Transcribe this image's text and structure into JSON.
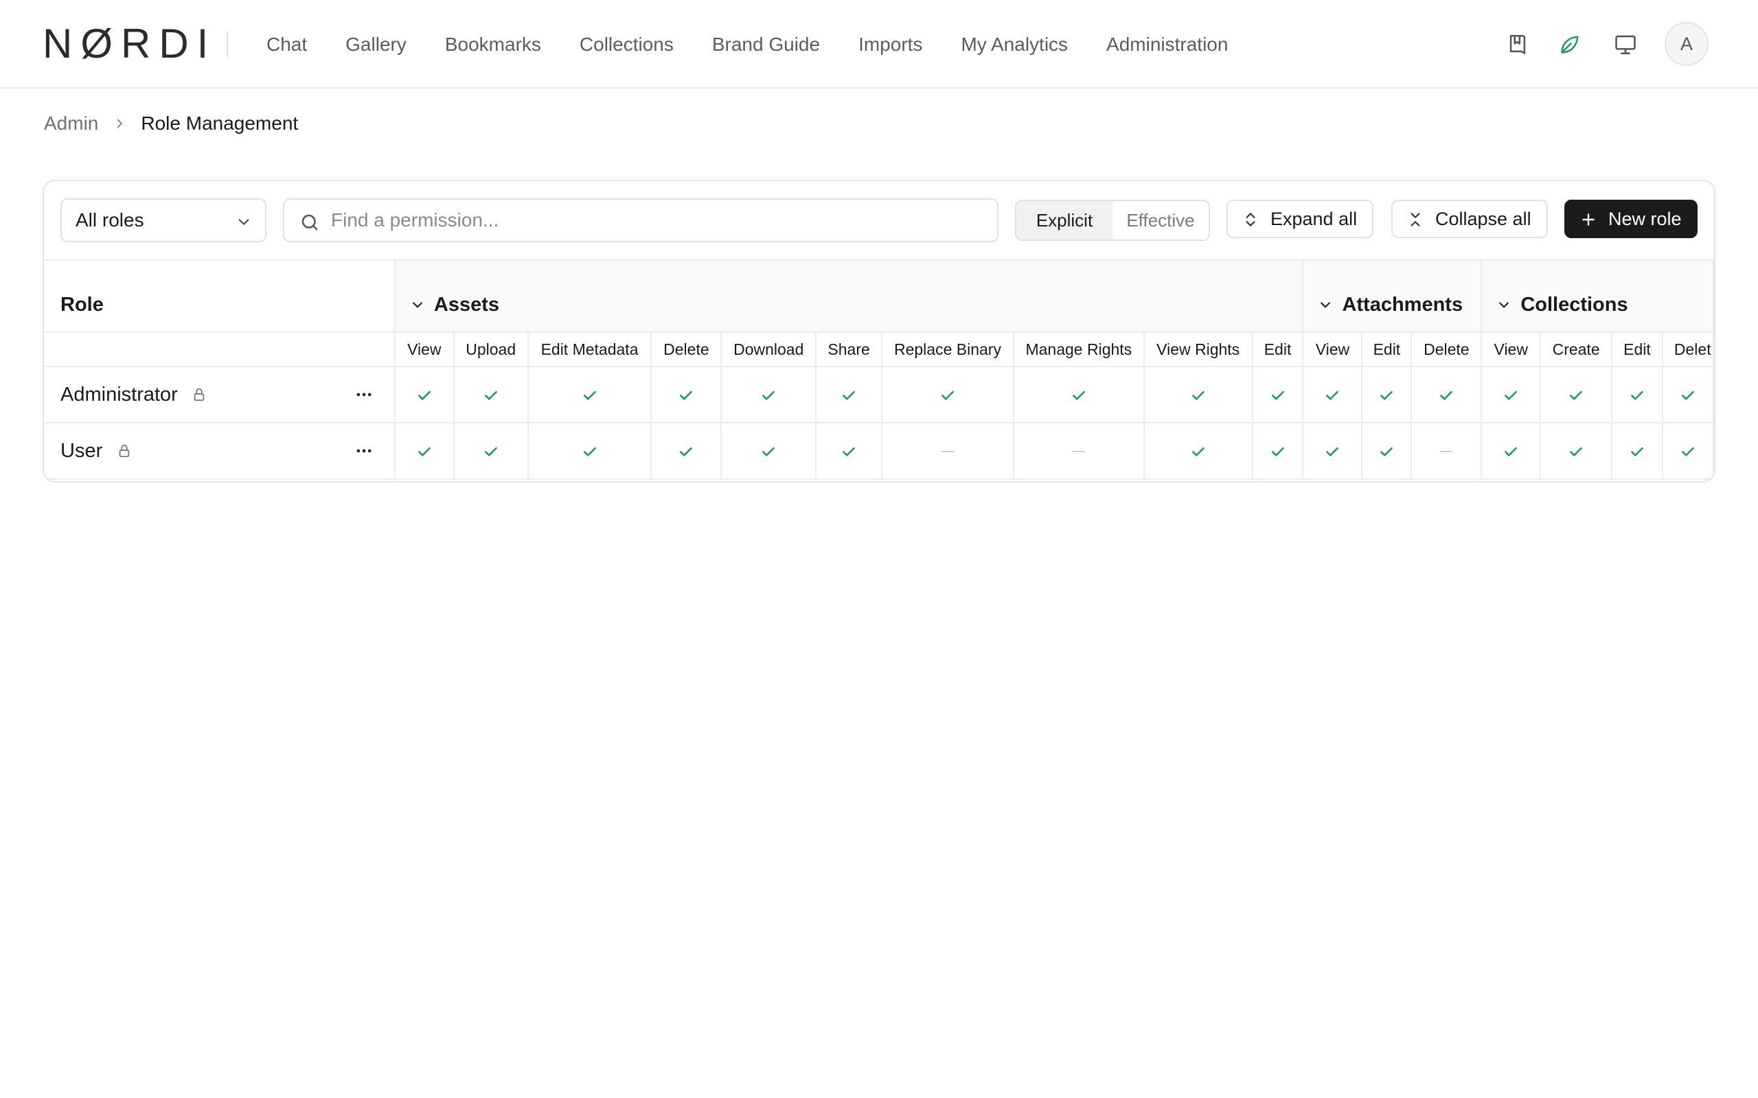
{
  "brand": {
    "logo": "NØRDI"
  },
  "nav": {
    "items": [
      "Chat",
      "Gallery",
      "Bookmarks",
      "Collections",
      "Brand Guide",
      "Imports",
      "My Analytics",
      "Administration"
    ]
  },
  "header_icons": [
    "bookmark-book-icon",
    "leaf-icon",
    "monitor-icon"
  ],
  "user": {
    "avatar_initial": "A"
  },
  "colors": {
    "accent_green": "#1e9e5a",
    "primary_button": "#1b1b1b"
  },
  "breadcrumb": {
    "parent": "Admin",
    "current": "Role Management"
  },
  "toolbar": {
    "role_filter": "All roles",
    "search_placeholder": "Find a permission...",
    "view_modes": [
      "Explicit",
      "Effective"
    ],
    "active_view_mode": "Explicit",
    "expand_all": "Expand all",
    "collapse_all": "Collapse all",
    "new_role": "New role"
  },
  "table": {
    "role_header": "Role",
    "groups": [
      {
        "name": "Assets",
        "permissions": [
          "View",
          "Upload",
          "Edit Metadata",
          "Delete",
          "Download",
          "Share",
          "Replace Binary",
          "Manage Rights",
          "View Rights",
          "Edit"
        ]
      },
      {
        "name": "Attachments",
        "permissions": [
          "View",
          "Edit",
          "Delete"
        ]
      },
      {
        "name": "Collections",
        "permissions": [
          "View",
          "Create",
          "Edit",
          "Delet"
        ]
      }
    ],
    "roles": [
      {
        "name": "Administrator",
        "locked": true,
        "grants": [
          true,
          true,
          true,
          true,
          true,
          true,
          true,
          true,
          true,
          true,
          true,
          true,
          true,
          true,
          true,
          true,
          true
        ]
      },
      {
        "name": "User",
        "locked": true,
        "grants": [
          true,
          true,
          true,
          true,
          true,
          true,
          false,
          false,
          true,
          true,
          true,
          true,
          false,
          true,
          true,
          true,
          true
        ]
      }
    ]
  }
}
